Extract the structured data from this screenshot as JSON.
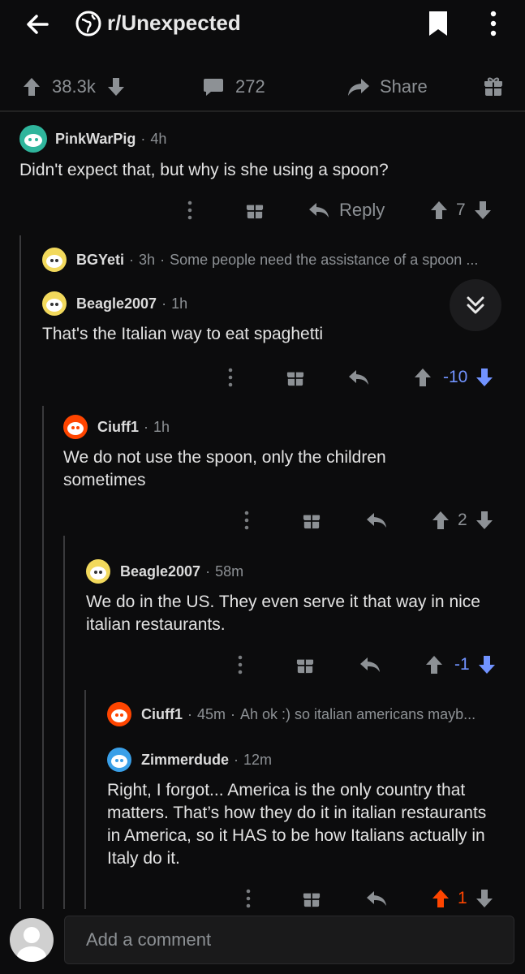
{
  "header": {
    "subreddit": "r/Unexpected"
  },
  "post_bar": {
    "upvotes": "38.3k",
    "comments": "272",
    "share_label": "Share"
  },
  "comments": [
    {
      "user": "PinkWarPig",
      "age": "4h",
      "body": "Didn't expect that, but why is she using a spoon?",
      "reply_label": "Reply",
      "score": "7",
      "vote": "none"
    },
    {
      "user": "BGYeti",
      "age": "3h",
      "preview": "Some people need the assistance of a spoon ...",
      "collapsed": true
    },
    {
      "user": "Beagle2007",
      "age": "1h",
      "body": "That's the Italian way to eat spaghetti",
      "score": "-10",
      "vote": "down"
    },
    {
      "user": "Ciuff1",
      "age": "1h",
      "body": "We do not use the spoon, only the children sometimes",
      "score": "2",
      "vote": "none"
    },
    {
      "user": "Beagle2007",
      "age": "58m",
      "body": "We do in the US. They even serve it that way in nice italian restaurants.",
      "score": "-1",
      "vote": "down"
    },
    {
      "user": "Ciuff1",
      "age": "45m",
      "preview": "Ah ok :) so italian americans mayb...",
      "collapsed": true
    },
    {
      "user": "Zimmerdude",
      "age": "12m",
      "body": "Right, I forgot... America is the only country that matters. That’s how they do it in italian restaurants in America, so it HAS to be how Italians actually in Italy do it.",
      "score": "1",
      "vote": "up"
    }
  ],
  "composer": {
    "placeholder": "Add a comment"
  },
  "colors": {
    "upvote": "#ff4500",
    "downvote": "#7193ff",
    "text_muted": "#8d9195"
  },
  "icons": [
    "back-arrow-icon",
    "subreddit-globe-icon",
    "bookmark-icon",
    "kebab-menu-icon",
    "upvote-arrow-icon",
    "downvote-arrow-icon",
    "comment-bubble-icon",
    "share-arrow-icon",
    "gift-icon",
    "reply-arrow-icon",
    "double-chevron-down-icon",
    "avatar-icon"
  ]
}
